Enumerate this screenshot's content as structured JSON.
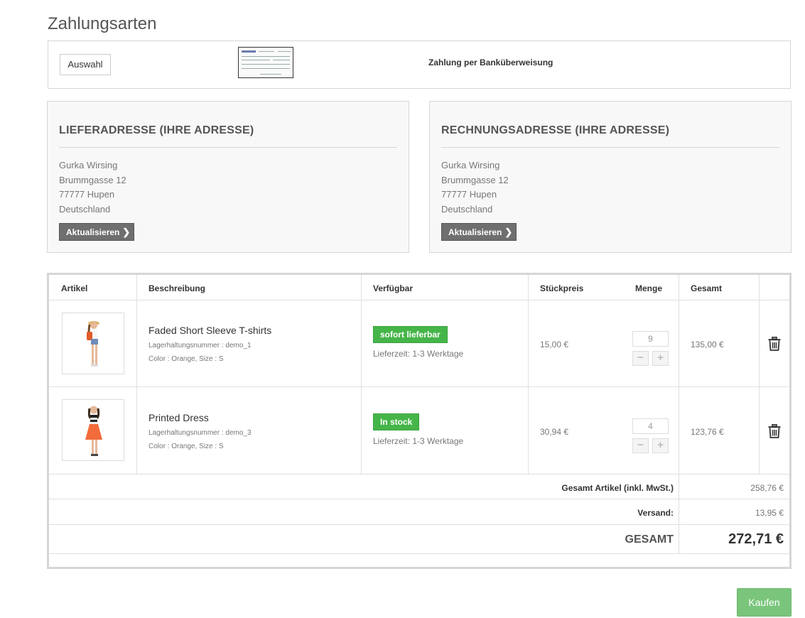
{
  "page": {
    "title": "Zahlungsarten"
  },
  "payment": {
    "select_label": "Auswahl",
    "method_label": "Zahlung per Banküberweisung",
    "logo_icon": "bank-transfer-form-icon"
  },
  "shipping_address": {
    "title": "LIEFERADRESSE (IHRE ADRESSE)",
    "lines": [
      "Gurka Wirsing",
      "Brummgasse 12",
      "77777 Hupen",
      "Deutschland"
    ],
    "update_label": "Aktualisieren"
  },
  "billing_address": {
    "title": "RECHNUNGSADRESSE (IHRE ADRESSE)",
    "lines": [
      "Gurka Wirsing",
      "Brummgasse 12",
      "77777 Hupen",
      "Deutschland"
    ],
    "update_label": "Aktualisieren"
  },
  "cart": {
    "headers": {
      "article": "Artikel",
      "description": "Beschreibung",
      "availability": "Verfügbar",
      "unit_price": "Stückpreis",
      "quantity": "Menge",
      "total": "Gesamt"
    },
    "items": [
      {
        "name": "Faded Short Sleeve T-shirts",
        "sku": "Lagerhaltungsnummer : demo_1",
        "attributes": "Color : Orange, Size : S",
        "availability": "sofort lieferbar",
        "delivery": "Lieferzeit: 1-3 Werktage",
        "unit_price": "15,00 €",
        "quantity": "9",
        "total": "135,00 €",
        "badge_color": "#46b549"
      },
      {
        "name": "Printed Dress",
        "sku": "Lagerhaltungsnummer : demo_3",
        "attributes": "Color : Orange, Size : S",
        "availability": "In stock",
        "delivery": "Lieferzeit: 1-3 Werktage",
        "unit_price": "30,94 €",
        "quantity": "4",
        "total": "123,76 €",
        "badge_color": "#46b549"
      }
    ],
    "summary": {
      "subtotal_label": "Gesamt Artikel (inkl. MwSt.)",
      "subtotal_value": "258,76 €",
      "shipping_label": "Versand:",
      "shipping_value": "13,95 €",
      "grand_total_label": "GESAMT",
      "grand_total_value": "272,71 €"
    }
  },
  "checkout": {
    "buy_label": "Kaufen",
    "buy_color": "#7ac57c"
  }
}
